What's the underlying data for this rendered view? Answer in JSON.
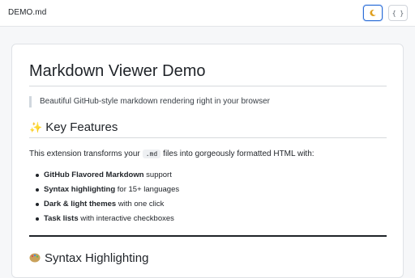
{
  "header": {
    "filename": "DEMO.md",
    "theme_button_icon": "moon-icon",
    "raw_button_label": "{ }"
  },
  "document": {
    "title": "Markdown Viewer Demo",
    "quote": "Beautiful GitHub-style markdown rendering right in your browser",
    "features_heading": "Key Features",
    "intro_before_code": "This extension transforms your",
    "intro_code": ".md",
    "intro_after_code": "files into gorgeously formatted HTML with:",
    "features": [
      {
        "bold": "GitHub Flavored Markdown",
        "rest": " support"
      },
      {
        "bold": "Syntax highlighting",
        "rest": " for 15+ languages"
      },
      {
        "bold": "Dark & light themes",
        "rest": " with one click"
      },
      {
        "bold": "Task lists",
        "rest": " with interactive checkboxes"
      }
    ],
    "next_heading": "Syntax Highlighting"
  },
  "colors": {
    "accent": "#2f6fd6",
    "text": "#1f2328",
    "muted": "#57606a"
  }
}
